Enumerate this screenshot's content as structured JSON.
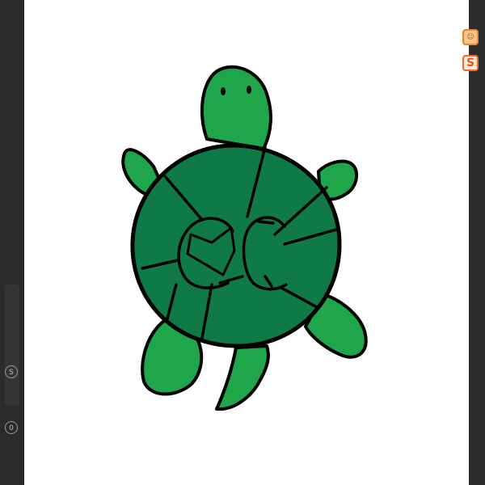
{
  "left_rail": {
    "buttons": [
      {
        "icon": "s-circle-icon",
        "glyph": "S"
      },
      {
        "icon": "zero-circle-icon",
        "glyph": "0"
      }
    ]
  },
  "tray": {
    "icons": [
      {
        "name": "app-icon",
        "glyph": "☺"
      },
      {
        "name": "sogou-input-icon",
        "glyph": "S"
      }
    ]
  },
  "drawing": {
    "shell_text": "CC",
    "colors": {
      "body": "#1fa64a",
      "shell": "#0f7a45",
      "outline": "#000000",
      "canvas": "#ffffff"
    }
  }
}
